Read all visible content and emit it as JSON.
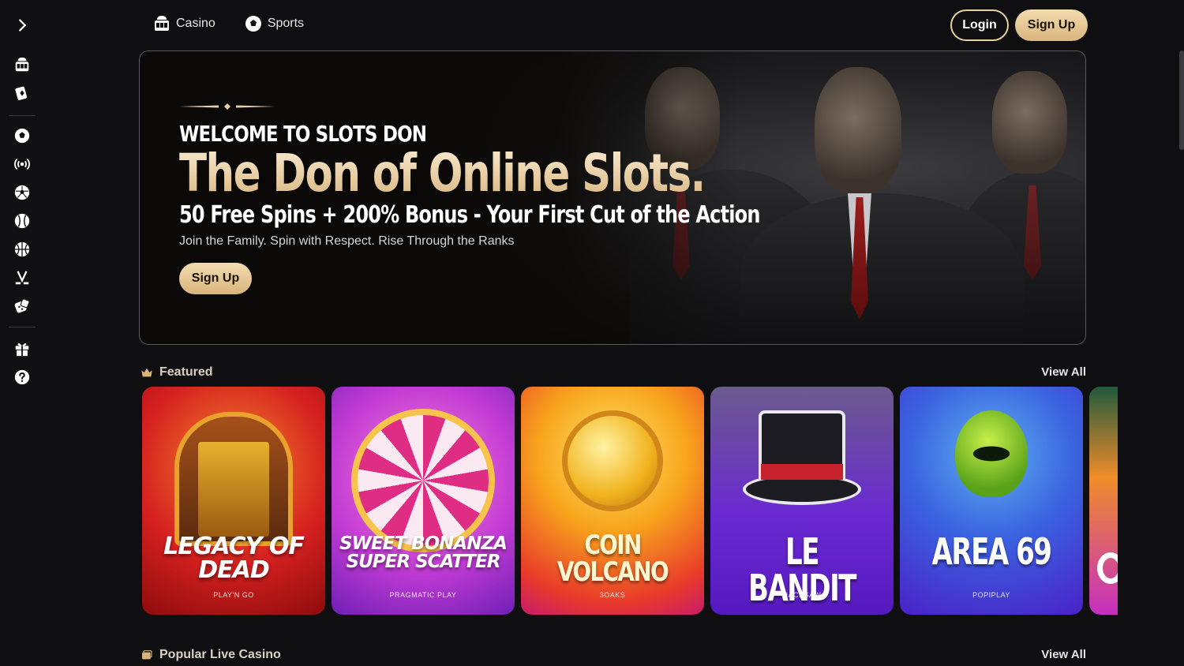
{
  "nav": {
    "casino_label": "Casino",
    "sports_label": "Sports"
  },
  "auth": {
    "login_label": "Login",
    "signup_label": "Sign Up"
  },
  "sidebar": {
    "toggle_icon": "chevron-right-icon",
    "items": [
      {
        "icon": "slot-machine-icon"
      },
      {
        "icon": "cards-icon"
      },
      {
        "icon": "sports-ball-icon"
      },
      {
        "icon": "live-broadcast-icon"
      },
      {
        "icon": "soccer-icon"
      },
      {
        "icon": "baseball-icon"
      },
      {
        "icon": "basketball-icon"
      },
      {
        "icon": "hockey-icon"
      },
      {
        "icon": "dice-icon"
      },
      {
        "icon": "gift-icon"
      },
      {
        "icon": "help-icon"
      }
    ]
  },
  "hero": {
    "eyebrow": "WELCOME TO SLOTS DON",
    "title": "The Don of Online Slots.",
    "subtitle": "50 Free Spins + 200% Bonus - Your First Cut of the Action",
    "description": "Join the Family. Spin with Respect. Rise Through the Ranks",
    "cta_label": "Sign Up"
  },
  "featured": {
    "title": "Featured",
    "view_all": "View All",
    "games": [
      {
        "title": "LEGACY OF DEAD",
        "provider": "PLAY'N GO",
        "color": "#d11f1f"
      },
      {
        "title": "SWEET BONANZA SUPER SCATTER",
        "provider": "PRAGMATIC PLAY",
        "color": "#b43bd6"
      },
      {
        "title": "COIN VOLCANO",
        "provider": "3OAKS",
        "color": "#f06a1c"
      },
      {
        "title": "LE BANDIT",
        "provider": "HACKSAW",
        "color": "#6b2ad1"
      },
      {
        "title": "AREA 69",
        "provider": "POPIPLAY",
        "color": "#3a2fd4"
      }
    ]
  },
  "live": {
    "title": "Popular Live Casino",
    "view_all": "View All"
  },
  "colors": {
    "accent": "#e8cfa0",
    "background": "#0f0f12"
  }
}
